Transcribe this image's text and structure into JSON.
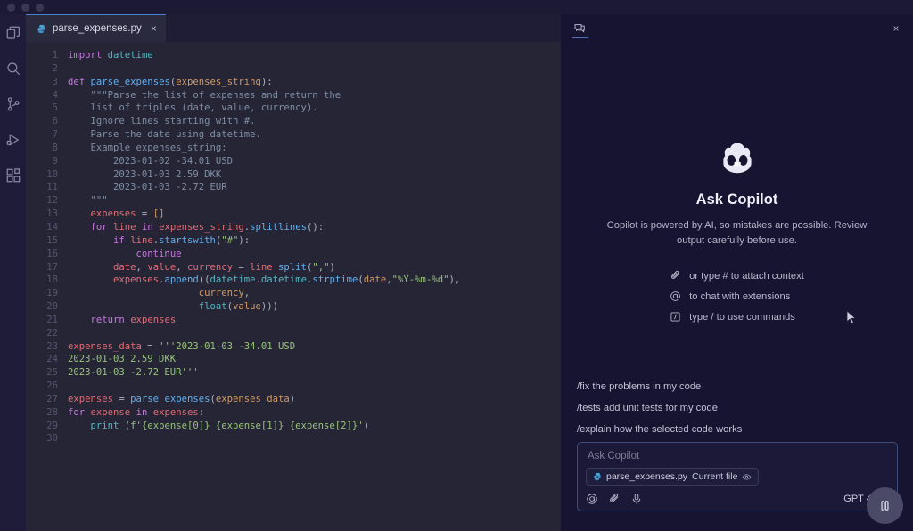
{
  "window": {
    "traffic_lights": [
      "close",
      "minimize",
      "maximize"
    ]
  },
  "activity_bar": {
    "items": [
      {
        "name": "explorer-icon",
        "label": "Explorer"
      },
      {
        "name": "search-icon",
        "label": "Search"
      },
      {
        "name": "source-control-icon",
        "label": "Source Control"
      },
      {
        "name": "run-debug-icon",
        "label": "Run and Debug"
      },
      {
        "name": "extensions-icon",
        "label": "Extensions"
      }
    ]
  },
  "editor": {
    "tab": {
      "filename": "parse_expenses.py",
      "close_label": "×"
    },
    "lines": [
      {
        "n": 1,
        "tokens": [
          {
            "t": "import",
            "c": "kw"
          },
          {
            "t": " ",
            "c": "plain"
          },
          {
            "t": "datetime",
            "c": "bi"
          }
        ]
      },
      {
        "n": 2,
        "tokens": []
      },
      {
        "n": 3,
        "tokens": [
          {
            "t": "def",
            "c": "kw"
          },
          {
            "t": " ",
            "c": "plain"
          },
          {
            "t": "parse_expenses",
            "c": "fn"
          },
          {
            "t": "(",
            "c": "pun"
          },
          {
            "t": "expenses_string",
            "c": "par"
          },
          {
            "t": "):",
            "c": "pun"
          }
        ]
      },
      {
        "n": 4,
        "tokens": [
          {
            "t": "    \"\"\"Parse the list of expenses and return the",
            "c": "doc"
          }
        ]
      },
      {
        "n": 5,
        "tokens": [
          {
            "t": "    list of triples (date, value, currency).",
            "c": "doc"
          }
        ]
      },
      {
        "n": 6,
        "tokens": [
          {
            "t": "    Ignore lines starting with #.",
            "c": "doc"
          }
        ]
      },
      {
        "n": 7,
        "tokens": [
          {
            "t": "    Parse the date using datetime.",
            "c": "doc"
          }
        ]
      },
      {
        "n": 8,
        "tokens": [
          {
            "t": "    Example expenses_string:",
            "c": "doc"
          }
        ]
      },
      {
        "n": 9,
        "tokens": [
          {
            "t": "        2023-01-02 -34.01 USD",
            "c": "doc"
          }
        ]
      },
      {
        "n": 10,
        "tokens": [
          {
            "t": "        2023-01-03 2.59 DKK",
            "c": "doc"
          }
        ]
      },
      {
        "n": 11,
        "tokens": [
          {
            "t": "        2023-01-03 -2.72 EUR",
            "c": "doc"
          }
        ]
      },
      {
        "n": 12,
        "tokens": [
          {
            "t": "    \"\"\"",
            "c": "doc"
          }
        ]
      },
      {
        "n": 13,
        "tokens": [
          {
            "t": "    ",
            "c": "plain"
          },
          {
            "t": "expenses",
            "c": "var"
          },
          {
            "t": " = ",
            "c": "pun"
          },
          {
            "t": "[]",
            "c": "par"
          }
        ]
      },
      {
        "n": 14,
        "tokens": [
          {
            "t": "    ",
            "c": "plain"
          },
          {
            "t": "for",
            "c": "kw"
          },
          {
            "t": " ",
            "c": "plain"
          },
          {
            "t": "line",
            "c": "var"
          },
          {
            "t": " ",
            "c": "plain"
          },
          {
            "t": "in",
            "c": "kw"
          },
          {
            "t": " ",
            "c": "plain"
          },
          {
            "t": "expenses_string",
            "c": "var"
          },
          {
            "t": ".",
            "c": "pun"
          },
          {
            "t": "splitlines",
            "c": "fn"
          },
          {
            "t": "():",
            "c": "pun"
          }
        ]
      },
      {
        "n": 15,
        "tokens": [
          {
            "t": "        ",
            "c": "plain"
          },
          {
            "t": "if",
            "c": "kw"
          },
          {
            "t": " ",
            "c": "plain"
          },
          {
            "t": "line",
            "c": "var"
          },
          {
            "t": ".",
            "c": "pun"
          },
          {
            "t": "startswith",
            "c": "fn"
          },
          {
            "t": "(",
            "c": "pun"
          },
          {
            "t": "\"#\"",
            "c": "str"
          },
          {
            "t": "):",
            "c": "pun"
          }
        ]
      },
      {
        "n": 16,
        "tokens": [
          {
            "t": "            ",
            "c": "plain"
          },
          {
            "t": "continue",
            "c": "kw"
          }
        ]
      },
      {
        "n": 17,
        "tokens": [
          {
            "t": "        ",
            "c": "plain"
          },
          {
            "t": "date",
            "c": "var"
          },
          {
            "t": ", ",
            "c": "pun"
          },
          {
            "t": "value",
            "c": "var"
          },
          {
            "t": ", ",
            "c": "pun"
          },
          {
            "t": "currency",
            "c": "var"
          },
          {
            "t": " = ",
            "c": "pun"
          },
          {
            "t": "line",
            "c": "var"
          },
          {
            "t": " ",
            "c": "plain"
          },
          {
            "t": "split",
            "c": "fn"
          },
          {
            "t": "(",
            "c": "pun"
          },
          {
            "t": "\",\"",
            "c": "str"
          },
          {
            "t": ")",
            "c": "pun"
          }
        ]
      },
      {
        "n": 18,
        "tokens": [
          {
            "t": "        ",
            "c": "plain"
          },
          {
            "t": "expenses",
            "c": "var"
          },
          {
            "t": ".",
            "c": "pun"
          },
          {
            "t": "append",
            "c": "fn"
          },
          {
            "t": "((",
            "c": "pun"
          },
          {
            "t": "datetime",
            "c": "bi"
          },
          {
            "t": ".",
            "c": "pun"
          },
          {
            "t": "datetime",
            "c": "bi"
          },
          {
            "t": ".",
            "c": "pun"
          },
          {
            "t": "strptime",
            "c": "fn"
          },
          {
            "t": "(",
            "c": "pun"
          },
          {
            "t": "date",
            "c": "par"
          },
          {
            "t": ",",
            "c": "pun"
          },
          {
            "t": "\"%Y-%m-%d\"",
            "c": "str"
          },
          {
            "t": "),",
            "c": "pun"
          }
        ]
      },
      {
        "n": 19,
        "tokens": [
          {
            "t": "                       ",
            "c": "plain"
          },
          {
            "t": "currency",
            "c": "par"
          },
          {
            "t": ",",
            "c": "pun"
          }
        ]
      },
      {
        "n": 20,
        "tokens": [
          {
            "t": "                       ",
            "c": "plain"
          },
          {
            "t": "float",
            "c": "bi"
          },
          {
            "t": "(",
            "c": "pun"
          },
          {
            "t": "value",
            "c": "par"
          },
          {
            "t": ")))",
            "c": "pun"
          }
        ]
      },
      {
        "n": 21,
        "tokens": [
          {
            "t": "    ",
            "c": "plain"
          },
          {
            "t": "return",
            "c": "kw"
          },
          {
            "t": " ",
            "c": "plain"
          },
          {
            "t": "expenses",
            "c": "var"
          }
        ]
      },
      {
        "n": 22,
        "tokens": []
      },
      {
        "n": 23,
        "tokens": [
          {
            "t": "expenses_data",
            "c": "var"
          },
          {
            "t": " = ",
            "c": "pun"
          },
          {
            "t": "'''2023-01-03 -34.01 USD",
            "c": "str"
          }
        ]
      },
      {
        "n": 24,
        "tokens": [
          {
            "t": "2023-01-03 2.59 DKK",
            "c": "str"
          }
        ]
      },
      {
        "n": 25,
        "tokens": [
          {
            "t": "2023-01-03 -2.72 EUR'''",
            "c": "str"
          }
        ]
      },
      {
        "n": 26,
        "tokens": []
      },
      {
        "n": 27,
        "tokens": [
          {
            "t": "expenses",
            "c": "var"
          },
          {
            "t": " = ",
            "c": "pun"
          },
          {
            "t": "parse_expenses",
            "c": "fn"
          },
          {
            "t": "(",
            "c": "pun"
          },
          {
            "t": "expenses_data",
            "c": "par"
          },
          {
            "t": ")",
            "c": "pun"
          }
        ]
      },
      {
        "n": 28,
        "tokens": [
          {
            "t": "for",
            "c": "kw"
          },
          {
            "t": " ",
            "c": "plain"
          },
          {
            "t": "expense",
            "c": "var"
          },
          {
            "t": " ",
            "c": "plain"
          },
          {
            "t": "in",
            "c": "kw"
          },
          {
            "t": " ",
            "c": "plain"
          },
          {
            "t": "expenses",
            "c": "var"
          },
          {
            "t": ":",
            "c": "pun"
          }
        ]
      },
      {
        "n": 29,
        "tokens": [
          {
            "t": "    ",
            "c": "plain"
          },
          {
            "t": "print",
            "c": "bi"
          },
          {
            "t": " (",
            "c": "pun"
          },
          {
            "t": "f'",
            "c": "str"
          },
          {
            "t": "{expense[0]} {expense[1]} {expense[2]}",
            "c": "str"
          },
          {
            "t": "'",
            "c": "str"
          },
          {
            "t": ")",
            "c": "pun"
          }
        ]
      },
      {
        "n": 30,
        "tokens": []
      }
    ]
  },
  "copilot_panel": {
    "tab_icon": "chat-icon",
    "close_label": "×",
    "title": "Ask Copilot",
    "description": "Copilot is powered by AI, so mistakes are possible. Review output carefully before use.",
    "hints": [
      {
        "icon": "paperclip-icon",
        "text": "or type # to attach context"
      },
      {
        "icon": "at-icon",
        "text": "to chat with extensions"
      },
      {
        "icon": "slash-command-icon",
        "text": "type / to use commands"
      }
    ],
    "slash_commands": [
      "/fix the problems in my code",
      "/tests add unit tests for my code",
      "/explain how the selected code works"
    ],
    "input": {
      "placeholder": "Ask Copilot",
      "context_chip": {
        "filename": "parse_expenses.py",
        "scope": "Current file",
        "icon": "eye-icon"
      },
      "footer_icons": [
        {
          "name": "at-icon"
        },
        {
          "name": "paperclip-icon"
        },
        {
          "name": "microphone-icon"
        }
      ],
      "model": "GPT 4o"
    },
    "pause_button": "pause-icon"
  },
  "colors": {
    "editor_bg": "#252536",
    "panel_bg": "#161430",
    "activity_bg": "#1f1c3a",
    "accent": "#4a7fd0",
    "tab_active_bg": "#2a2a3e"
  }
}
